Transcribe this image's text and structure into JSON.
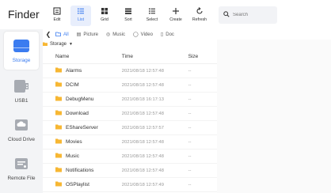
{
  "app": {
    "title": "Finder"
  },
  "toolbar": [
    {
      "label": "Edit",
      "icon": "edit-icon",
      "active": false
    },
    {
      "label": "List",
      "icon": "list-icon",
      "active": true
    },
    {
      "label": "Grid",
      "icon": "grid-icon",
      "active": false
    },
    {
      "label": "Sort",
      "icon": "sort-icon",
      "active": false
    },
    {
      "label": "Select",
      "icon": "select-icon",
      "active": false
    },
    {
      "label": "Create",
      "icon": "plus-icon",
      "active": false
    },
    {
      "label": "Refresh",
      "icon": "refresh-icon",
      "active": false
    }
  ],
  "search": {
    "placeholder": "Search",
    "icon": "search-icon"
  },
  "sidebar": {
    "items": [
      {
        "label": "Storage",
        "icon": "storage-icon",
        "active": true
      },
      {
        "label": "USB1",
        "icon": "usb-drive-icon",
        "active": false
      },
      {
        "label": "Cloud Drive",
        "icon": "cloud-drive-icon",
        "active": false
      },
      {
        "label": "Remote File",
        "icon": "remote-file-icon",
        "active": false
      }
    ]
  },
  "filters": [
    {
      "label": "All",
      "icon": "all-icon",
      "active": true
    },
    {
      "label": "Picture",
      "icon": "picture-icon",
      "active": false
    },
    {
      "label": "Music",
      "icon": "music-icon",
      "active": false
    },
    {
      "label": "Video",
      "icon": "video-icon",
      "active": false
    },
    {
      "label": "Doc",
      "icon": "doc-icon",
      "active": false
    }
  ],
  "breadcrumb": {
    "label": "Storage"
  },
  "table": {
    "headers": {
      "name": "Name",
      "time": "Time",
      "size": "Size"
    },
    "rows": [
      {
        "name": "Alarms",
        "time": "2021/08/18 12:57:48",
        "size": "--"
      },
      {
        "name": "DCIM",
        "time": "2021/08/18 12:57:48",
        "size": "--"
      },
      {
        "name": "DebugMenu",
        "time": "2021/08/18 16:17:13",
        "size": "--"
      },
      {
        "name": "Download",
        "time": "2021/08/18 12:57:48",
        "size": "--"
      },
      {
        "name": "EShareServer",
        "time": "2021/08/18 12:57:57",
        "size": "--"
      },
      {
        "name": "Movies",
        "time": "2021/08/18 12:57:48",
        "size": "--"
      },
      {
        "name": "Music",
        "time": "2021/08/18 12:57:48",
        "size": "--"
      },
      {
        "name": "Notifications",
        "time": "2021/08/18 12:57:48",
        "size": "--"
      },
      {
        "name": "OSPlaylist",
        "time": "2021/08/18 12:57:49",
        "size": "--"
      }
    ]
  },
  "colors": {
    "accent": "#3b7cf0",
    "folder": "#f7b733",
    "sidebar_bg": "#f3f4f6"
  }
}
